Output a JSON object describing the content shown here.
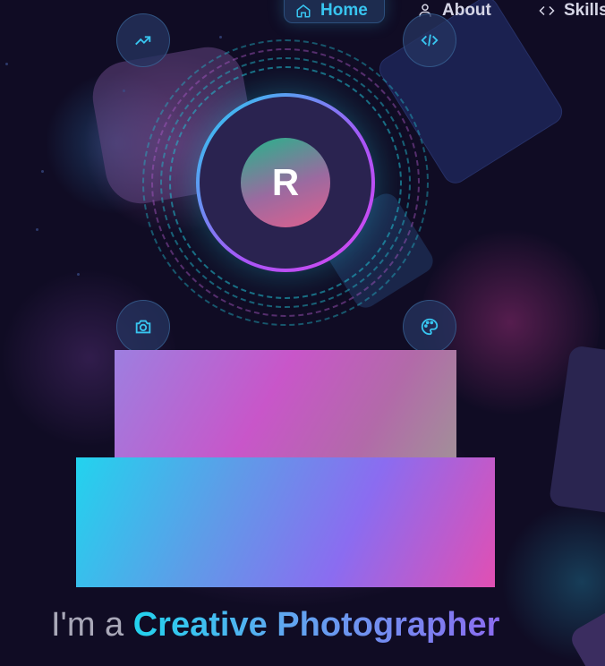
{
  "nav": {
    "items": [
      {
        "label": "Home",
        "icon": "home-icon",
        "active": true
      },
      {
        "label": "About",
        "icon": "user-icon",
        "active": false
      },
      {
        "label": "Skills",
        "icon": "code-icon",
        "active": false
      }
    ]
  },
  "profile": {
    "initial": "R",
    "floating_icons": [
      "trending-up-icon",
      "code-icon",
      "camera-icon",
      "palette-icon"
    ]
  },
  "hero": {
    "prefix": "I'm a",
    "highlight": "Creative Photographer"
  },
  "colors": {
    "background": "#100c24",
    "accent_cyan": "#22d3ee",
    "accent_purple": "#a855f7",
    "accent_pink": "#e14fb3"
  }
}
